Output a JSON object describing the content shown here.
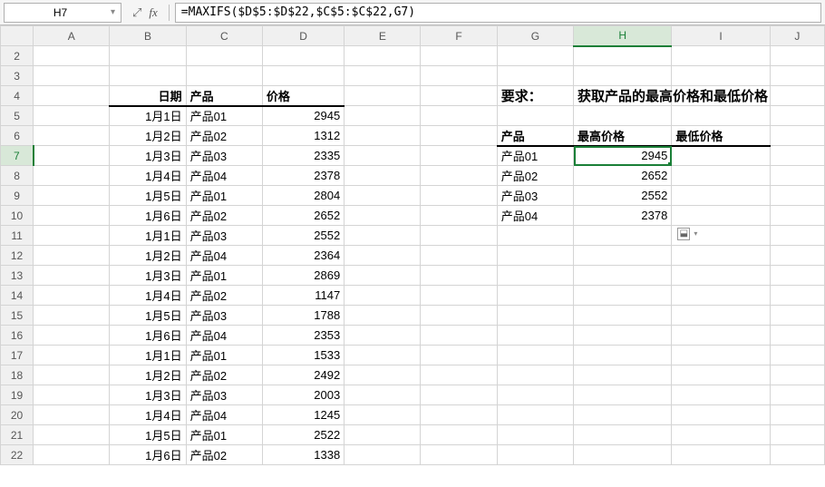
{
  "nameBox": "H7",
  "formula": "=MAXIFS($D$5:$D$22,$C$5:$C$22,G7)",
  "columns": [
    "A",
    "B",
    "C",
    "D",
    "E",
    "F",
    "G",
    "H",
    "I",
    "J"
  ],
  "rowStart": 2,
  "rowEnd": 22,
  "activeRow": 7,
  "activeCol": "H",
  "headers": {
    "B4": "日期",
    "C4": "产品",
    "D4": "价格",
    "G4": "要求：",
    "H4": "获取产品的最高价格和最低价格",
    "G6": "产品",
    "H6": "最高价格",
    "I6": "最低价格"
  },
  "table1": [
    {
      "date": "1月1日",
      "prod": "产品01",
      "price": 2945
    },
    {
      "date": "1月2日",
      "prod": "产品02",
      "price": 1312
    },
    {
      "date": "1月3日",
      "prod": "产品03",
      "price": 2335
    },
    {
      "date": "1月4日",
      "prod": "产品04",
      "price": 2378
    },
    {
      "date": "1月5日",
      "prod": "产品01",
      "price": 2804
    },
    {
      "date": "1月6日",
      "prod": "产品02",
      "price": 2652
    },
    {
      "date": "1月1日",
      "prod": "产品03",
      "price": 2552
    },
    {
      "date": "1月2日",
      "prod": "产品04",
      "price": 2364
    },
    {
      "date": "1月3日",
      "prod": "产品01",
      "price": 2869
    },
    {
      "date": "1月4日",
      "prod": "产品02",
      "price": 1147
    },
    {
      "date": "1月5日",
      "prod": "产品03",
      "price": 1788
    },
    {
      "date": "1月6日",
      "prod": "产品04",
      "price": 2353
    },
    {
      "date": "1月1日",
      "prod": "产品01",
      "price": 1533
    },
    {
      "date": "1月2日",
      "prod": "产品02",
      "price": 2492
    },
    {
      "date": "1月3日",
      "prod": "产品03",
      "price": 2003
    },
    {
      "date": "1月4日",
      "prod": "产品04",
      "price": 1245
    },
    {
      "date": "1月5日",
      "prod": "产品01",
      "price": 2522
    },
    {
      "date": "1月6日",
      "prod": "产品02",
      "price": 1338
    }
  ],
  "table2": [
    {
      "prod": "产品01",
      "max": 2945
    },
    {
      "prod": "产品02",
      "max": 2652
    },
    {
      "prod": "产品03",
      "max": 2552
    },
    {
      "prod": "产品04",
      "max": 2378
    }
  ],
  "icons": {
    "zoom": "⤢",
    "fill": "⬓"
  }
}
